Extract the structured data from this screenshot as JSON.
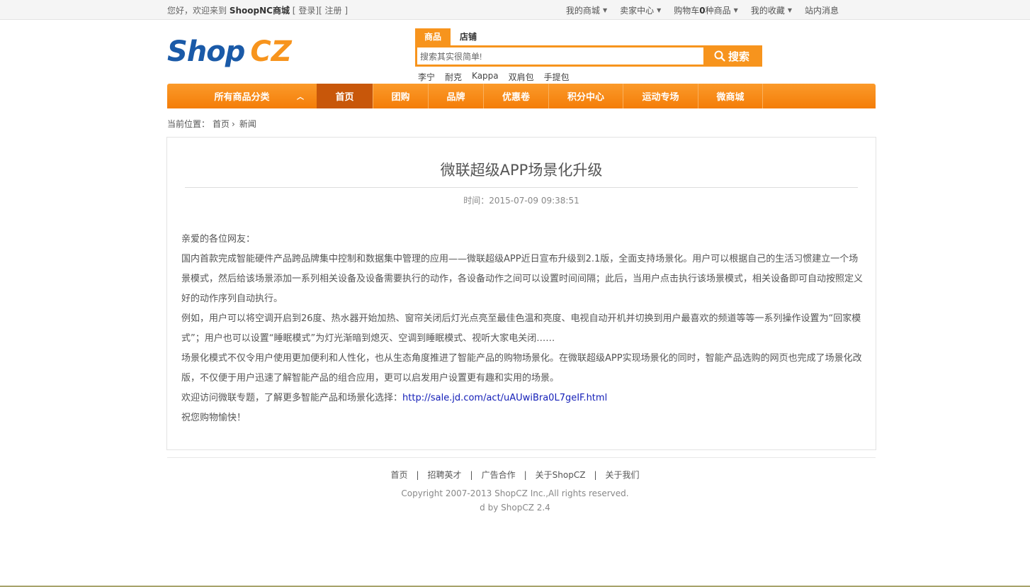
{
  "topbar": {
    "greeting": "您好，欢迎来到",
    "site_name": "ShoopNC商城",
    "login_open": "[",
    "login": "登录",
    "mid": "][",
    "register": "注册",
    "register_close": "]",
    "menu": [
      {
        "label": "我的商城",
        "has_caret": true
      },
      {
        "label": "卖家中心",
        "has_caret": true
      },
      {
        "label_prefix": "购物车",
        "count": "0",
        "label_suffix": "种商品",
        "has_caret": true
      },
      {
        "label": "我的收藏",
        "has_caret": true
      },
      {
        "label": "站内消息",
        "has_caret": false
      }
    ]
  },
  "logo": {
    "part1": "Shop",
    "part2": "CZ"
  },
  "search": {
    "tabs": [
      "商品",
      "店铺"
    ],
    "active_tab": 0,
    "value": "搜索其实很简单!",
    "button_label": "搜索",
    "hot_keywords": [
      "李宁",
      "耐克",
      "Kappa",
      "双肩包",
      "手提包"
    ]
  },
  "nav": {
    "all_categories": "所有商品分类",
    "items": [
      {
        "label": "首页",
        "active": true
      },
      {
        "label": "团购"
      },
      {
        "label": "品牌"
      },
      {
        "label": "优惠卷"
      },
      {
        "label": "积分中心"
      },
      {
        "label": "运动专场"
      },
      {
        "label": "微商城"
      }
    ]
  },
  "breadcrumb": {
    "prefix": "当前位置：",
    "home": "首页",
    "sep": "›",
    "current": "新闻"
  },
  "article": {
    "title": "微联超级APP场景化升级",
    "time": "时间：2015-07-09 09:38:51",
    "paragraphs": [
      "亲爱的各位网友：",
      "国内首款完成智能硬件产品跨品牌集中控制和数据集中管理的应用——微联超级APP近日宣布升级到2.1版，全面支持场景化。用户可以根据自己的生活习惯建立一个场景模式，然后给该场景添加一系列相关设备及设备需要执行的动作，各设备动作之间可以设置时间间隔；此后，当用户点击执行该场景模式，相关设备即可自动按照定义好的动作序列自动执行。",
      "例如，用户可以将空调开启到26度、热水器开始加热、窗帘关闭后灯光点亮至最佳色温和亮度、电视自动开机并切换到用户最喜欢的频道等等一系列操作设置为“回家模式”；用户也可以设置“睡眠模式”为灯光渐暗到熄灭、空调到睡眠模式、视听大家电关闭……",
      "场景化模式不仅令用户使用更加便利和人性化，也从生态角度推进了智能产品的购物场景化。在微联超级APP实现场景化的同时，智能产品选购的网页也完成了场景化改版，不仅便于用户迅速了解智能产品的组合应用，更可以启发用户设置更有趣和实用的场景。"
    ],
    "visit_text": "欢迎访问微联专题，了解更多智能产品和场景化选择：",
    "visit_link": "http://sale.jd.com/act/uAUwiBra0L7geIF.html",
    "closing": "祝您购物愉快！"
  },
  "footer": {
    "links": [
      "首页",
      "招聘英才",
      "广告合作",
      "关于ShopCZ",
      "关于我们"
    ],
    "separator": "|",
    "copyright": "Copyright 2007-2013 ShopCZ Inc.,All rights reserved.",
    "powered": "d by ShopCZ 2.4"
  },
  "colors": {
    "accent": "#f7941d",
    "nav_active": "#c8570a",
    "logo_blue": "#1a5aa8",
    "link": "#1520b8"
  }
}
